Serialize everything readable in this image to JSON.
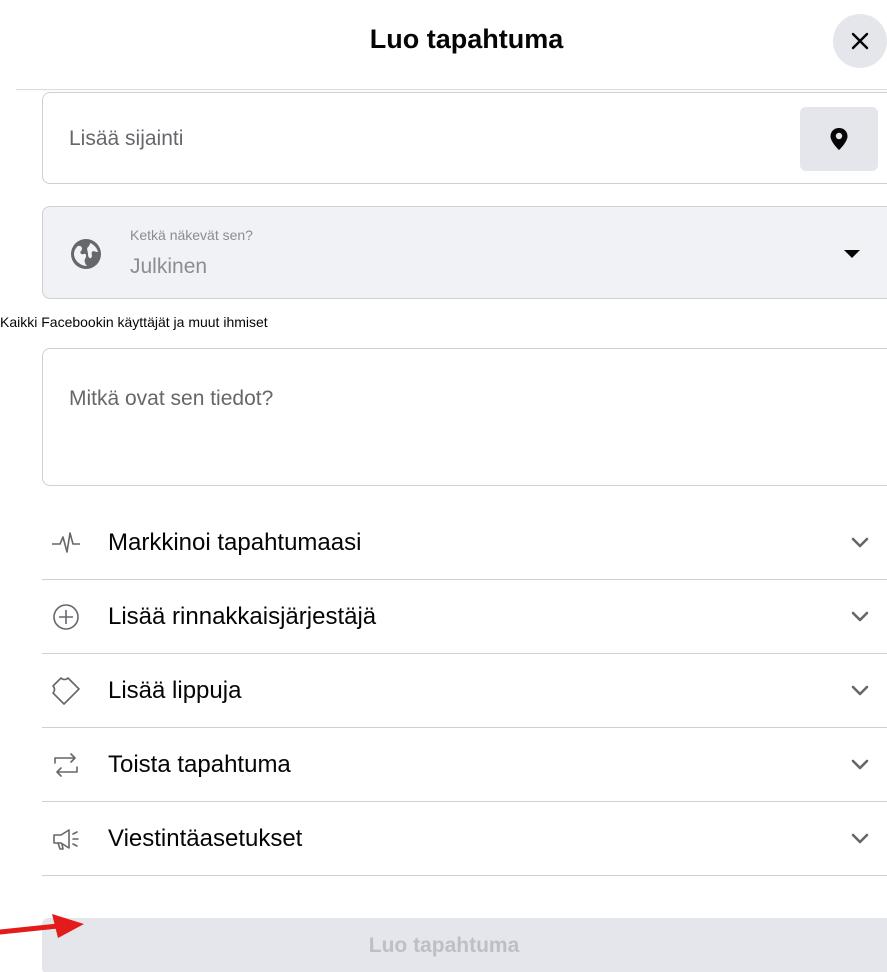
{
  "dialog": {
    "title": "Luo tapahtuma"
  },
  "location": {
    "placeholder": "Lisää sijainti"
  },
  "privacy": {
    "label": "Ketkä näkevät sen?",
    "value": "Julkinen",
    "helper": "Kaikki Facebookin käyttäjät ja muut ihmiset"
  },
  "details": {
    "placeholder": "Mitkä ovat sen tiedot?"
  },
  "sections": [
    {
      "label": "Markkinoi tapahtumaasi",
      "icon": "pulse-icon"
    },
    {
      "label": "Lisää rinnakkaisjärjestäjä",
      "icon": "plus-circle-icon"
    },
    {
      "label": "Lisää lippuja",
      "icon": "ticket-icon"
    },
    {
      "label": "Toista tapahtuma",
      "icon": "repeat-icon"
    },
    {
      "label": "Viestintäasetukset",
      "icon": "megaphone-icon"
    }
  ],
  "submit": {
    "label": "Luo tapahtuma"
  },
  "colors": {
    "annotation_arrow": "#e41b1b",
    "button_disabled_bg": "#e4e6eb",
    "button_disabled_text": "#bcc0c4"
  }
}
